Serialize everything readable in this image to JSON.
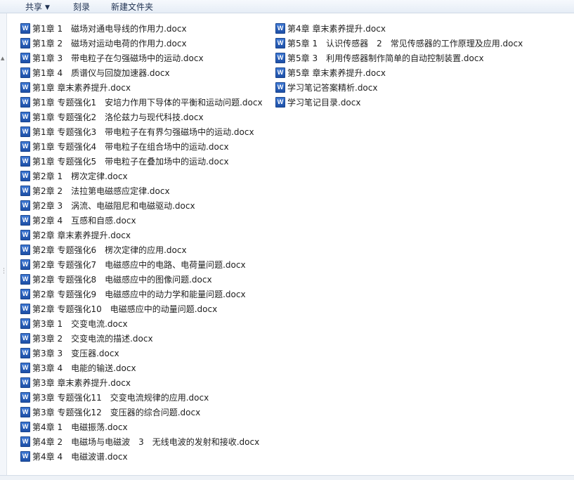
{
  "toolbar": {
    "share_label": "共享",
    "burn_label": "刻录",
    "new_folder_label": "新建文件夹",
    "share_arrow": "▼"
  },
  "icons": {
    "file_icon": "word-doc-icon",
    "icon_letter": "W",
    "icon_color": "#2b5fbf"
  },
  "files": [
    "第1章 1　磁场对通电导线的作用力.docx",
    "第1章 2　磁场对运动电荷的作用力.docx",
    "第1章 3　带电粒子在匀强磁场中的运动.docx",
    "第1章 4　质谱仪与回旋加速器.docx",
    "第1章 章末素养提升.docx",
    "第1章 专题强化1　安培力作用下导体的平衡和运动问题.docx",
    "第1章 专题强化2　洛伦兹力与现代科技.docx",
    "第1章 专题强化3　带电粒子在有界匀强磁场中的运动.docx",
    "第1章 专题强化4　带电粒子在组合场中的运动.docx",
    "第1章 专题强化5　带电粒子在叠加场中的运动.docx",
    "第2章 1　楞次定律.docx",
    "第2章 2　法拉第电磁感应定律.docx",
    "第2章 3　涡流、电磁阻尼和电磁驱动.docx",
    "第2章 4　互感和自感.docx",
    "第2章 章末素养提升.docx",
    "第2章 专题强化6　楞次定律的应用.docx",
    "第2章 专题强化7　电磁感应中的电路、电荷量问题.docx",
    "第2章 专题强化8　电磁感应中的图像问题.docx",
    "第2章 专题强化9　电磁感应中的动力学和能量问题.docx",
    "第2章 专题强化10　电磁感应中的动量问题.docx",
    "第3章 1　交变电流.docx",
    "第3章 2　交变电流的描述.docx",
    "第3章 3　变压器.docx",
    "第3章 4　电能的输送.docx",
    "第3章 章末素养提升.docx",
    "第3章 专题强化11　交变电流规律的应用.docx",
    "第3章 专题强化12　变压器的综合问题.docx",
    "第4章 1　电磁振荡.docx",
    "第4章 2　电磁场与电磁波　3　无线电波的发射和接收.docx",
    "第4章 4　电磁波谱.docx",
    "第4章 章末素养提升.docx",
    "第5章 1　认识传感器　2　常见传感器的工作原理及应用.docx",
    "第5章 3　利用传感器制作简单的自动控制装置.docx",
    "第5章 章末素养提升.docx",
    "学习笔记答案精析.docx",
    "学习笔记目录.docx"
  ]
}
